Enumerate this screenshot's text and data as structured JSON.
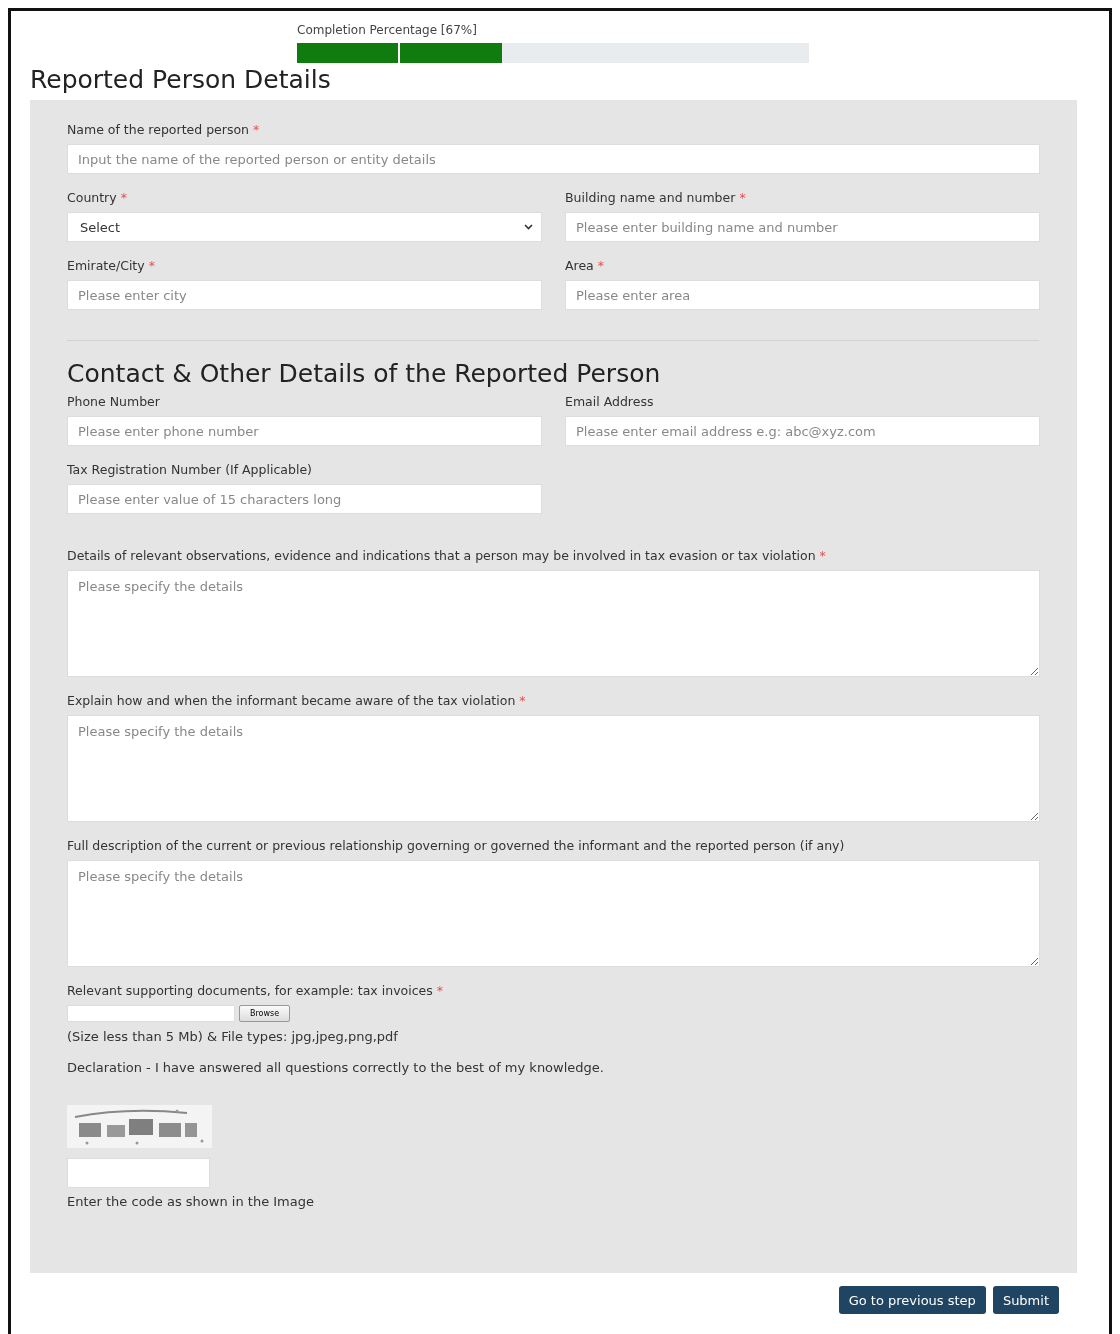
{
  "progress": {
    "label": "Completion Percentage [67%]",
    "level": 0.4
  },
  "title": "Reported Person Details",
  "section1": {
    "fields": [
      {
        "kind": "line",
        "label": "Name of the reported person",
        "marker": "*",
        "placeholder": "Input the name of the reported person or entity details"
      },
      {
        "kind": "select",
        "label": "Country",
        "marker": "*",
        "value": "Select"
      },
      {
        "kind": "text",
        "label": "Building name and number",
        "marker": "*",
        "placeholder": "Please enter building name and number"
      },
      {
        "kind": "text",
        "label": "Emirate/City",
        "marker": "*",
        "placeholder": "Please enter city"
      },
      {
        "kind": "text",
        "label": "Area",
        "marker": "*",
        "placeholder": "Please enter area"
      }
    ]
  },
  "section2": {
    "heading": "Contact & Other Details of the Reported Person",
    "fields": [
      {
        "kind": "text",
        "label": "Phone Number",
        "placeholder": "Please enter phone number"
      },
      {
        "kind": "text",
        "label": "Email Address",
        "placeholder": "Please enter email address e.g: abc@xyz.com"
      },
      {
        "kind": "text",
        "label": "Tax Registration Number (If Applicable)",
        "placeholder": "Please enter value of 15 characters long"
      },
      {
        "kind": "gap"
      },
      {
        "kind": "textarea",
        "label": "Details of relevant observations, evidence and indications that a person may be involved in tax evasion or tax violation",
        "marker": "*",
        "placeholder": "Please specify the details"
      },
      {
        "kind": "textarea",
        "label": "Explain how and when the informant became aware of the tax violation",
        "marker": "*",
        "placeholder": "Please specify the details"
      },
      {
        "kind": "textarea",
        "label": "Full description of the current or previous relationship governing or governed the informant and the reported person (if any)",
        "placeholder": "Please specify the details"
      }
    ]
  },
  "upload": {
    "label": "Relevant supporting documents, for example: tax invoices",
    "marker": "*",
    "browse": "Browse",
    "hint": "(Size less than 5 Mb) & File types: jpg,jpeg,png,pdf"
  },
  "declaration": "Declaration - I have answered all questions correctly to the best of my knowledge.",
  "captcha": {
    "kind": "picture",
    "hint": "Enter the code as shown in the Image"
  },
  "buttons": [
    "Go to previous step",
    "Submit"
  ]
}
